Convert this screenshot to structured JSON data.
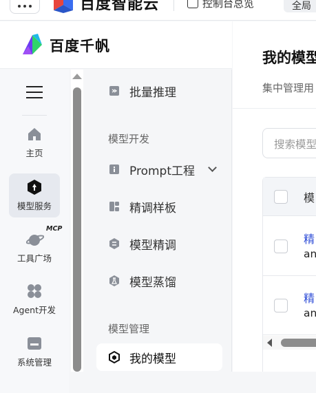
{
  "topbar": {
    "brand_text": "百度智能云",
    "link_label": "控制台总览",
    "pill_label": "全局"
  },
  "brand": {
    "name": "百度千帆"
  },
  "rail": {
    "items": [
      {
        "label": "主页",
        "icon": "home-icon"
      },
      {
        "label": "模型服务",
        "icon": "model-service-icon",
        "active": true
      },
      {
        "label": "工具广场",
        "icon": "tool-plaza-icon",
        "badge": "MCP"
      },
      {
        "label": "Agent开发",
        "icon": "agent-icon"
      },
      {
        "label": "系统管理",
        "icon": "system-icon"
      }
    ]
  },
  "subnav": {
    "batch_inference": "批量推理",
    "group_dev": "模型开发",
    "prompt": "Prompt工程",
    "finetune_template": "精调样板",
    "model_finetune": "模型精调",
    "model_distill": "模型蒸馏",
    "group_manage": "模型管理",
    "my_models": "我的模型"
  },
  "main": {
    "title": "我的模型",
    "description": "集中管理用",
    "search_placeholder": "搜索模型",
    "table": {
      "header": "模",
      "rows": [
        {
          "name": "精",
          "sub": "an"
        },
        {
          "name": "精",
          "sub": "an"
        }
      ]
    }
  },
  "colors": {
    "accent_link": "#2c4bd6",
    "active_nav_bg": "#e6e9ef"
  }
}
